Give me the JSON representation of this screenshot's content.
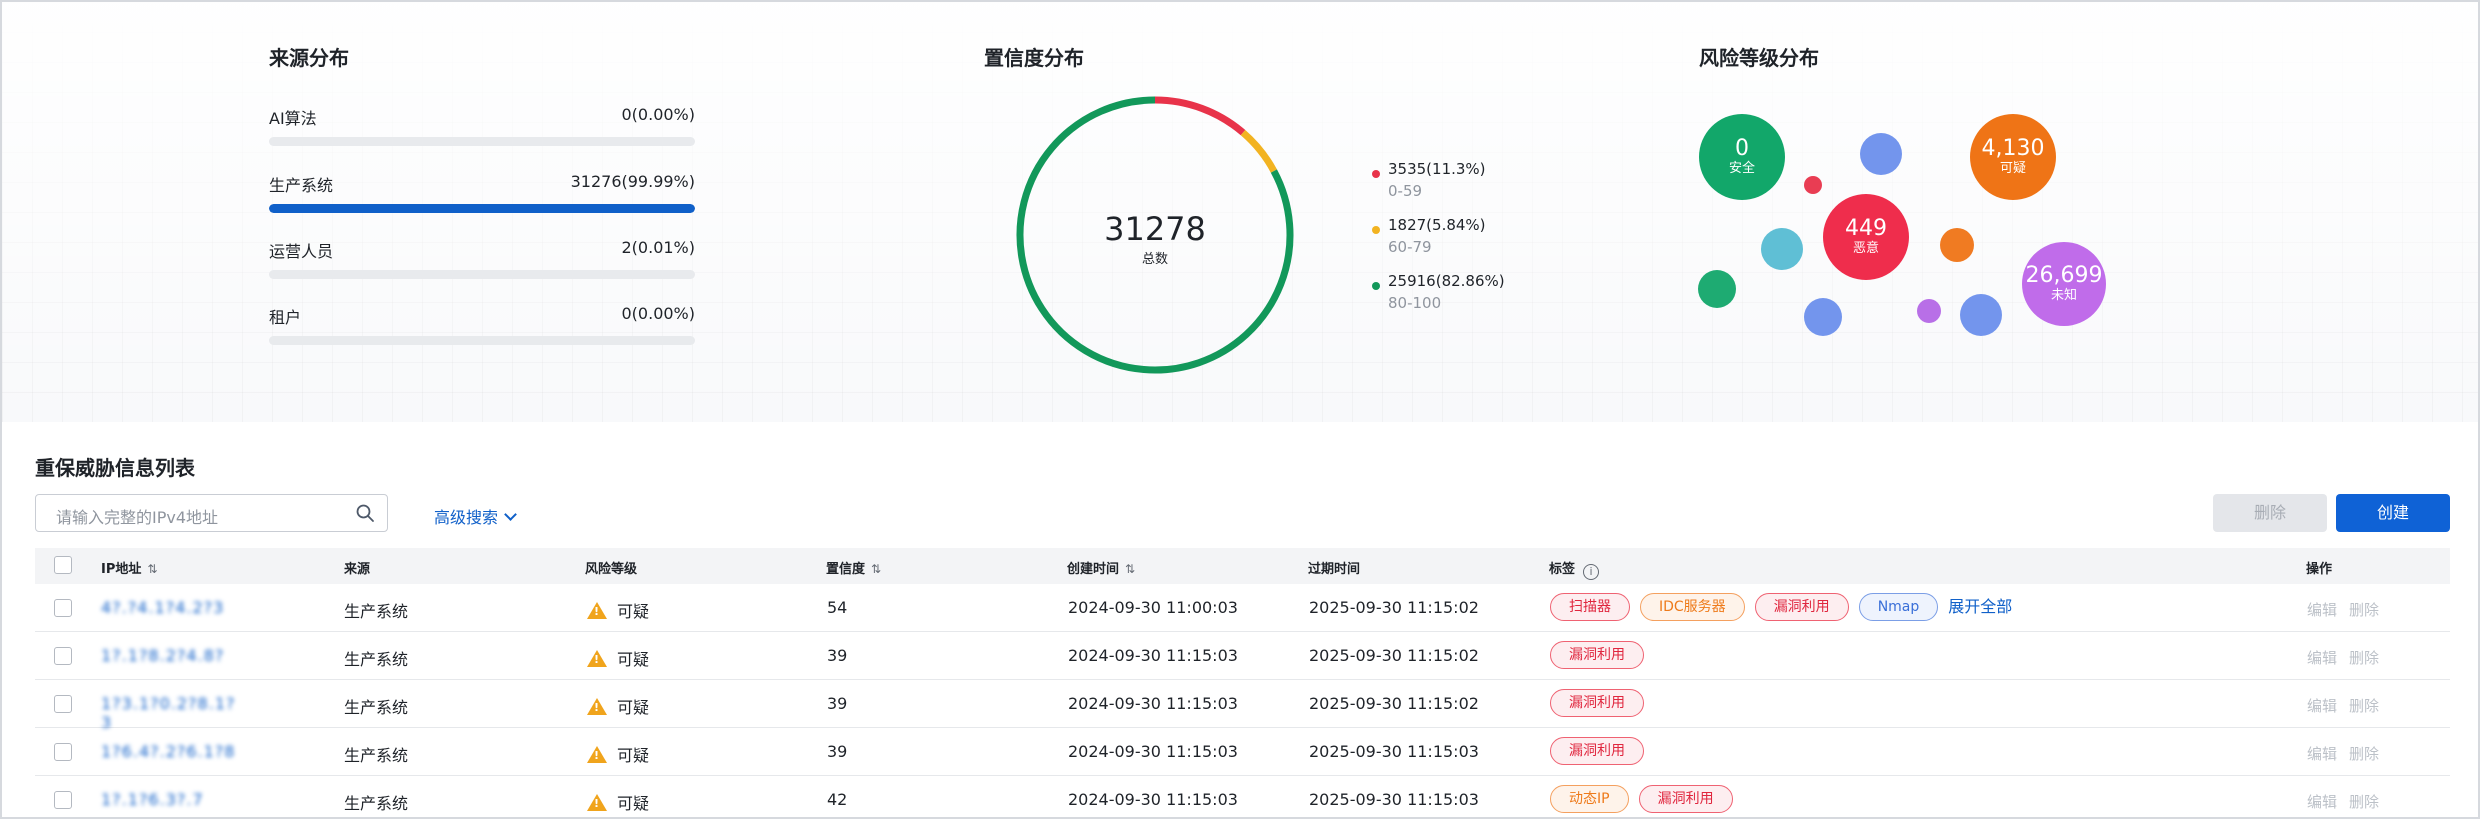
{
  "source_dist": {
    "title": "来源分布",
    "items": [
      {
        "label": "AI算法",
        "value": "0(0.00%)",
        "pct": 0.0
      },
      {
        "label": "生产系统",
        "value": "31276(99.99%)",
        "pct": 99.99
      },
      {
        "label": "运营人员",
        "value": "2(0.01%)",
        "pct": 0.01
      },
      {
        "label": "租户",
        "value": "0(0.00%)",
        "pct": 0.0
      }
    ]
  },
  "confidence_dist": {
    "title": "置信度分布",
    "total": "31278",
    "total_label": "总数",
    "segments": [
      {
        "value": "3535(11.3%)",
        "range": "0-59",
        "count": 3535,
        "color": "#e8334a"
      },
      {
        "value": "1827(5.84%)",
        "range": "60-79",
        "count": 1827,
        "color": "#f2b321"
      },
      {
        "value": "25916(82.86%)",
        "range": "80-100",
        "count": 25916,
        "color": "#12985a"
      }
    ]
  },
  "risk_dist": {
    "title": "风险等级分布",
    "labeled": [
      {
        "num": "0",
        "label": "安全",
        "color": "#12a76a"
      },
      {
        "num": "449",
        "label": "恶意",
        "color": "#ef2d4c"
      },
      {
        "num": "4,130",
        "label": "可疑",
        "color": "#ef7416"
      },
      {
        "num": "26,699",
        "label": "未知",
        "color": "#c06cea"
      }
    ],
    "small_colors": [
      "#e8334a",
      "#6b8fec",
      "#56bcd3",
      "#12a76a",
      "#6b8fec",
      "#ef7416",
      "#b467e6",
      "#6b8fec"
    ]
  },
  "list": {
    "title": "重保威胁信息列表",
    "search_placeholder": "请输入完整的IPv4地址",
    "advanced_search": "高级搜索",
    "delete_btn": "删除",
    "create_btn": "创建",
    "columns": [
      "IP地址",
      "来源",
      "风险等级",
      "置信度",
      "创建时间",
      "过期时间",
      "标签",
      "操作"
    ],
    "rows": [
      {
        "ip": "4?.?4.1?4.2?3",
        "source": "生产系统",
        "risk": "可疑",
        "conf": "54",
        "created": "2024-09-30 11:00:03",
        "expires": "2025-09-30 11:15:02",
        "tags": [
          {
            "t": "扫描器",
            "c": "red"
          },
          {
            "t": "IDC服务器",
            "c": "orange"
          },
          {
            "t": "漏洞利用",
            "c": "red"
          },
          {
            "t": "Nmap",
            "c": "blue"
          }
        ],
        "expand": "展开全部",
        "edit": "编辑",
        "del": "删除"
      },
      {
        "ip": "1?.1?8.2?4.8?",
        "source": "生产系统",
        "risk": "可疑",
        "conf": "39",
        "created": "2024-09-30 11:15:03",
        "expires": "2025-09-30 11:15:02",
        "tags": [
          {
            "t": "漏洞利用",
            "c": "red"
          }
        ],
        "expand": "",
        "edit": "编辑",
        "del": "删除"
      },
      {
        "ip": "1?3.1?0.2?8.1?3",
        "source": "生产系统",
        "risk": "可疑",
        "conf": "39",
        "created": "2024-09-30 11:15:03",
        "expires": "2025-09-30 11:15:02",
        "tags": [
          {
            "t": "漏洞利用",
            "c": "red"
          }
        ],
        "expand": "",
        "edit": "编辑",
        "del": "删除"
      },
      {
        "ip": "1?6.4?.2?6.1?8",
        "source": "生产系统",
        "risk": "可疑",
        "conf": "39",
        "created": "2024-09-30 11:15:03",
        "expires": "2025-09-30 11:15:03",
        "tags": [
          {
            "t": "漏洞利用",
            "c": "red"
          }
        ],
        "expand": "",
        "edit": "编辑",
        "del": "删除"
      },
      {
        "ip": "1?.1?6.3?.7",
        "source": "生产系统",
        "risk": "可疑",
        "conf": "42",
        "created": "2024-09-30 11:15:03",
        "expires": "2025-09-30 11:15:03",
        "tags": [
          {
            "t": "动态IP",
            "c": "orange"
          },
          {
            "t": "漏洞利用",
            "c": "red"
          }
        ],
        "expand": "",
        "edit": "编辑",
        "del": "删除"
      }
    ]
  }
}
